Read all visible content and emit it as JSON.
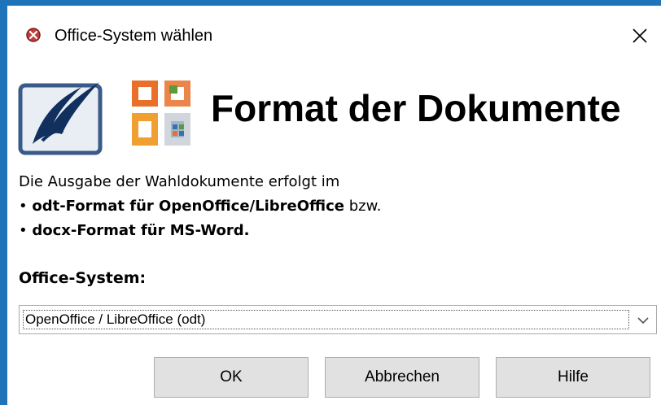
{
  "window": {
    "title": "Office-System wählen"
  },
  "header": {
    "heading": "Format der Dokumente"
  },
  "description": {
    "line1": "Die Ausgabe der Wahldokumente erfolgt im",
    "line2_bullet": "•",
    "line2_bold": "odt-Format für OpenOffice/LibreOffice",
    "line2_rest": " bzw.",
    "line3_bullet": "•",
    "line3_bold": "docx-Format für MS-Word."
  },
  "office_select": {
    "label": "Office-System:",
    "value": "OpenOffice / LibreOffice (odt)"
  },
  "buttons": {
    "ok": "OK",
    "cancel": "Abbrechen",
    "help": "Hilfe"
  },
  "colors": {
    "frame_accent": "#1f73b8",
    "button_face": "#e1e1e1"
  }
}
